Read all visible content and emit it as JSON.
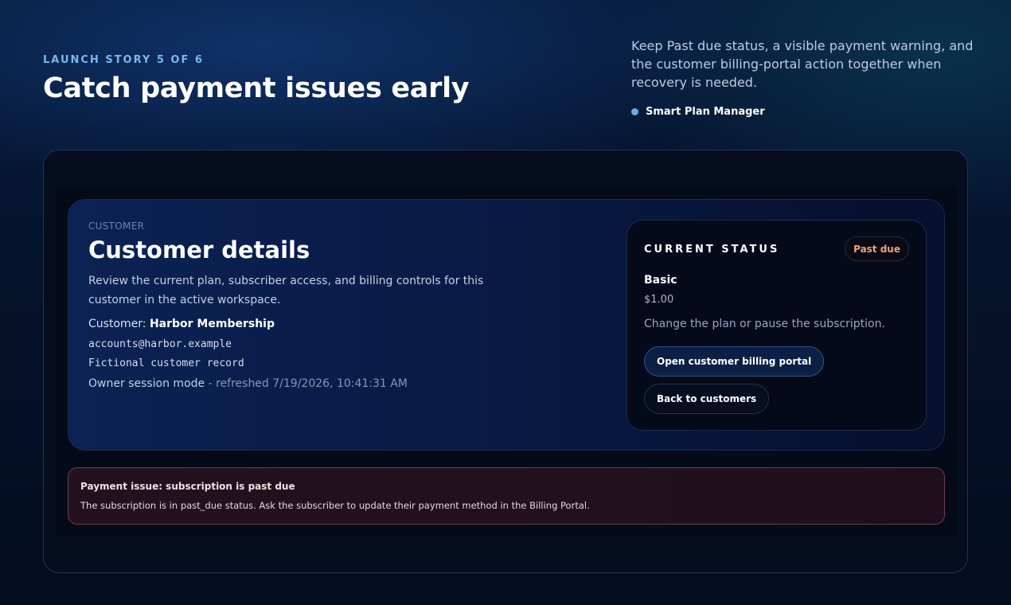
{
  "hero": {
    "eyebrow": "LAUNCH STORY 5 OF 6",
    "title": "Catch payment issues early",
    "description": "Keep Past due status, a visible payment warning, and the customer billing-portal action together when recovery is needed.",
    "brand": "Smart Plan Manager"
  },
  "customer": {
    "section_label": "CUSTOMER",
    "title": "Customer details",
    "description": "Review the current plan, subscriber access, and billing controls for this customer in the active workspace.",
    "name_label": "Customer:",
    "name": "Harbor Membership",
    "email": "accounts@harbor.example",
    "record_note": "Fictional customer record",
    "session_mode": "Owner session mode",
    "refreshed": " - refreshed 7/19/2026, 10:41:31 AM"
  },
  "status": {
    "heading": "CURRENT STATUS",
    "badge": "Past due",
    "plan_name": "Basic",
    "plan_price": "$1.00",
    "hint": "Change the plan or pause the subscription.",
    "portal_button": "Open customer billing portal",
    "back_button": "Back to customers"
  },
  "alert": {
    "title": "Payment issue: subscription is past due",
    "body": "The subscription is in past_due status. Ask the subscriber to update their payment method in the Billing Portal."
  },
  "colors": {
    "accent": "#79b8ee",
    "badge_text": "#eea27a",
    "alert_border": "#6a3d50"
  },
  "icons": {
    "brand": "status-dot-icon"
  }
}
